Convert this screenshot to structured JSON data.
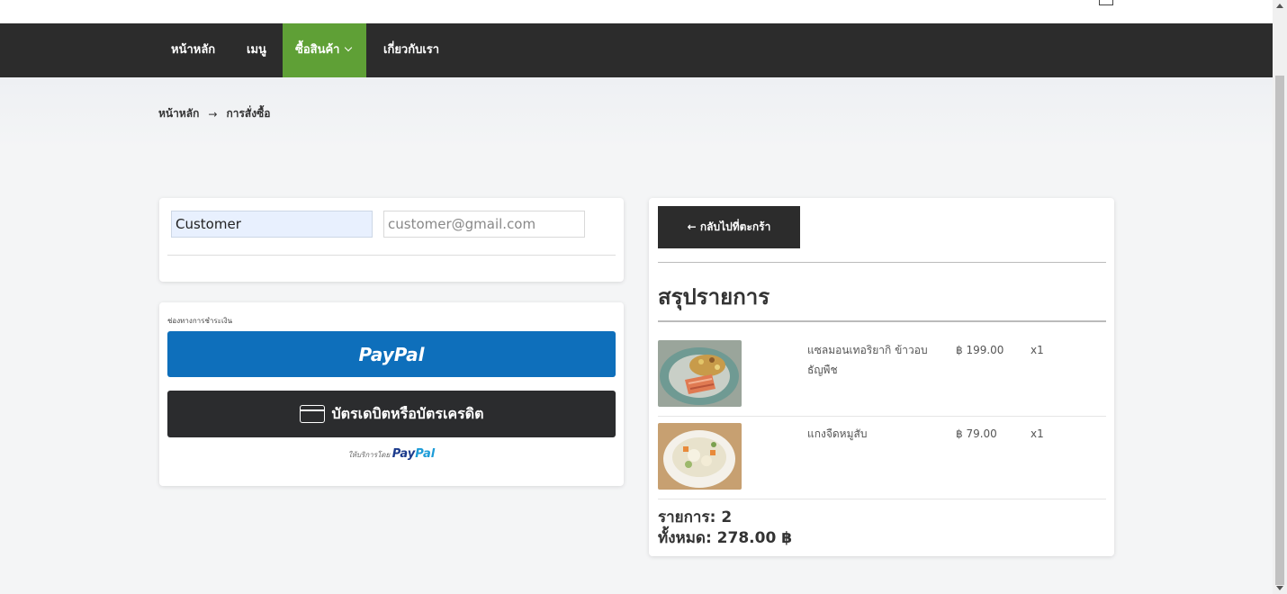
{
  "nav": {
    "items": [
      {
        "label": "หน้าหลัก"
      },
      {
        "label": "เมนู"
      },
      {
        "label": "ซื้อสินค้า"
      },
      {
        "label": "เกี่ยวกับเรา"
      }
    ],
    "active_color": "#5fa036",
    "background": "#2c2c2c"
  },
  "breadcrumb": {
    "home": "หน้าหลัก",
    "arrow": "→",
    "current": "การสั่งซื้อ"
  },
  "customer": {
    "name_value": "Customer",
    "email_value": "customer@gmail.com"
  },
  "payment": {
    "label": "ช่องทางการชำระเงิน",
    "paypal_button": "PayPal",
    "card_button": "บัตรเดบิตหรือบัตรเครดิต",
    "powered_by": "ให้บริการโดย",
    "powered_brand_a": "Pay",
    "powered_brand_b": "Pal",
    "paypal_color": "#0e6fbb"
  },
  "summary": {
    "back_button": "← กลับไปที่ตะกร้า",
    "title": "สรุปรายการ",
    "items": [
      {
        "name": "แซลมอนเทอริยากิ ข้าวอบธัญพืช",
        "price": "฿ 199.00",
        "qty": "x1"
      },
      {
        "name": "แกงจืดหมูสับ",
        "price": "฿ 79.00",
        "qty": "x1"
      }
    ],
    "count_line": "รายการ: 2",
    "total_line": "ทั้งหมด: 278.00 ฿"
  }
}
